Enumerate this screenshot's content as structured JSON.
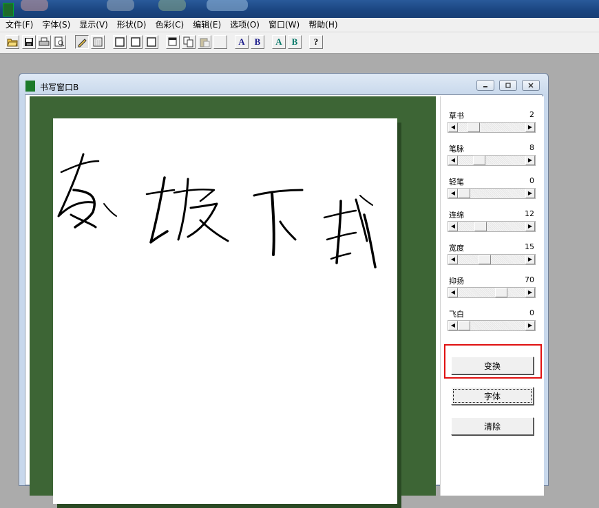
{
  "menu": [
    "文件(F)",
    "字体(S)",
    "显示(V)",
    "形状(D)",
    "色彩(C)",
    "编辑(E)",
    "选项(O)",
    "窗口(W)",
    "帮助(H)"
  ],
  "toolbar": {
    "letter_a": "A",
    "letter_b": "B",
    "letter_a2": "A",
    "letter_b2": "B",
    "help_glyph": "?",
    "serif_blue": "#1a1a8a",
    "serif_teal": "#0a7a6a"
  },
  "window": {
    "title": "书写窗口B"
  },
  "board": {
    "background_color": "#3d6535",
    "handwritten_text": "东坡下载"
  },
  "params": [
    {
      "label": "草书",
      "value": "2",
      "level": 0.12
    },
    {
      "label": "笔脉",
      "value": "8",
      "level": 0.25
    },
    {
      "label": "轻笔",
      "value": "0",
      "level": 0.0
    },
    {
      "label": "连绵",
      "value": "12",
      "level": 0.3
    },
    {
      "label": "宽度",
      "value": "15",
      "level": 0.37
    },
    {
      "label": "抑扬",
      "value": "70",
      "level": 0.8
    },
    {
      "label": "飞白",
      "value": "0",
      "level": 0.0
    }
  ],
  "buttons": {
    "transform": "变换",
    "font": "字体",
    "clear": "清除"
  }
}
